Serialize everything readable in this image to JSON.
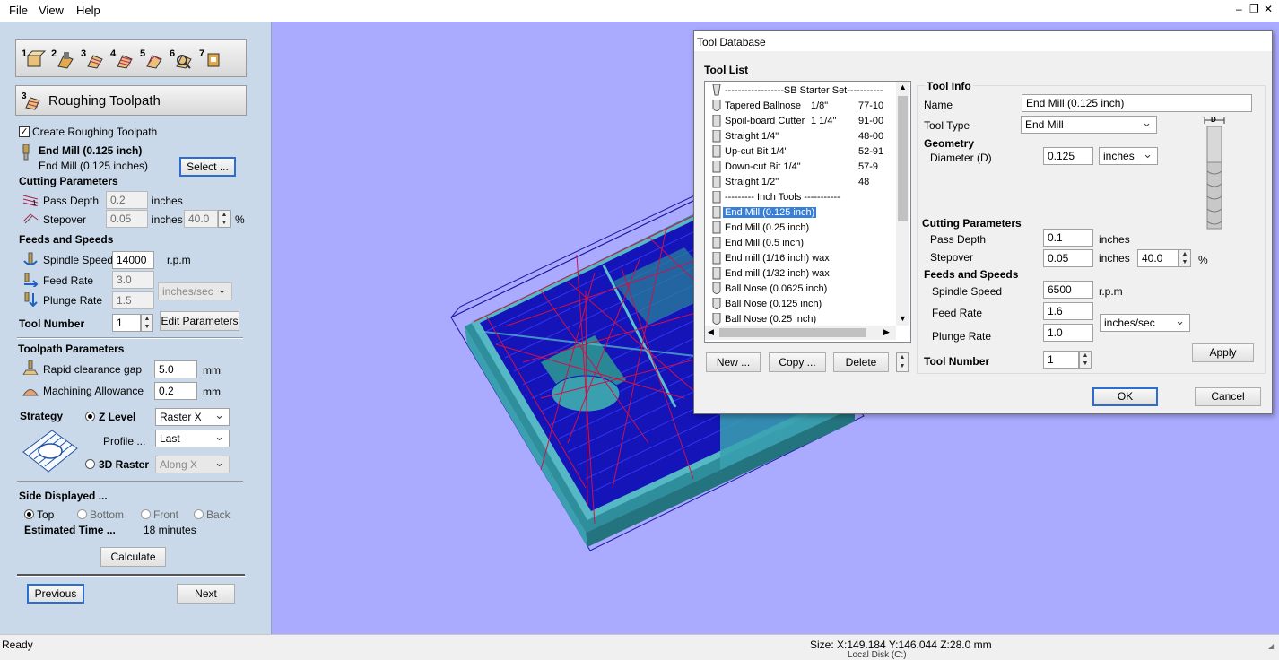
{
  "menu": {
    "file": "File",
    "view": "View",
    "help": "Help"
  },
  "window_controls": {
    "minimize": "–",
    "restore": "❐",
    "close": "✕"
  },
  "left": {
    "toolbar_numbers": [
      "1",
      "2",
      "3",
      "4",
      "5",
      "6",
      "7"
    ],
    "section_number": "3",
    "section_title": "Roughing Toolpath",
    "create_label": "Create Roughing Toolpath",
    "tool_name_bold": "End Mill (0.125 inch)",
    "tool_name": "End Mill (0.125 inches)",
    "select_button": "Select ...",
    "cutting_params": "Cutting Parameters",
    "pass_depth_label": "Pass Depth",
    "pass_depth_value": "0.2",
    "pass_depth_unit": "inches",
    "stepover_label": "Stepover",
    "stepover_value": "0.05",
    "stepover_unit": "inches",
    "stepover_pct": "40.0",
    "pct_sign": "%",
    "feeds_speeds": "Feeds and Speeds",
    "spindle_label": "Spindle Speed",
    "spindle_value": "14000",
    "spindle_unit": "r.p.m",
    "feed_label": "Feed Rate",
    "feed_value": "3.0",
    "plunge_label": "Plunge Rate",
    "plunge_value": "1.5",
    "rate_unit": "inches/sec",
    "tool_number_label": "Tool Number",
    "tool_number_value": "1",
    "edit_params_button": "Edit Parameters",
    "toolpath_params": "Toolpath Parameters",
    "rapid_label": "Rapid clearance gap",
    "rapid_value": "5.0",
    "rapid_unit": "mm",
    "allowance_label": "Machining Allowance",
    "allowance_value": "0.2",
    "allowance_unit": "mm",
    "strategy_label": "Strategy",
    "zlevel_label": "Z Level",
    "zlevel_select": "Raster X",
    "profile_label": "Profile ...",
    "profile_select": "Last",
    "raster3d_label": "3D Raster",
    "raster3d_select": "Along X",
    "side_displayed": "Side Displayed ...",
    "side_top": "Top",
    "side_bottom": "Bottom",
    "side_front": "Front",
    "side_back": "Back",
    "est_time_label": "Estimated Time ...",
    "est_time_value": "18 minutes",
    "calculate_button": "Calculate",
    "previous_button": "Previous",
    "next_button": "Next"
  },
  "status": {
    "left": "Ready",
    "size": "Size: X:149.184 Y:146.044 Z:28.0 mm",
    "taskbar_hint": "Local Disk (C:)"
  },
  "dialog": {
    "title": "Tool Database",
    "tool_list_label": "Tool List",
    "tools": [
      {
        "name": "------------------SB Starter Set-----------",
        "dia": "",
        "part": ""
      },
      {
        "name": "Tapered Ballnose",
        "dia": "1/8\"",
        "part": "77-10"
      },
      {
        "name": "Spoil-board Cutter",
        "dia": "1 1/4\"",
        "part": "91-00"
      },
      {
        "name": "Straight 1/4\"",
        "dia": "",
        "part": "48-00"
      },
      {
        "name": "Up-cut Bit 1/4\"",
        "dia": "",
        "part": "52-91"
      },
      {
        "name": "Down-cut Bit 1/4\"",
        "dia": "",
        "part": "57-9"
      },
      {
        "name": "Straight 1/2\"",
        "dia": "",
        "part": "48"
      },
      {
        "name": "--------- Inch Tools -----------",
        "dia": "",
        "part": ""
      },
      {
        "name": "End Mill (0.125 inch)",
        "dia": "",
        "part": ""
      },
      {
        "name": "End Mill (0.25 inch)",
        "dia": "",
        "part": ""
      },
      {
        "name": "End Mill (0.5 inch)",
        "dia": "",
        "part": ""
      },
      {
        "name": "End mill (1/16 inch) wax",
        "dia": "",
        "part": ""
      },
      {
        "name": "End mill (1/32 inch) wax",
        "dia": "",
        "part": ""
      },
      {
        "name": "Ball Nose (0.0625 inch)",
        "dia": "",
        "part": ""
      },
      {
        "name": "Ball Nose (0.125 inch)",
        "dia": "",
        "part": ""
      },
      {
        "name": "Ball Nose (0.25 inch)",
        "dia": "",
        "part": ""
      }
    ],
    "new_button": "New ...",
    "copy_button": "Copy ...",
    "delete_button": "Delete",
    "tool_info": "Tool Info",
    "name_label": "Name",
    "name_value": "End Mill (0.125 inch)",
    "tool_type_label": "Tool Type",
    "tool_type_value": "End Mill",
    "geometry": "Geometry",
    "diameter_label": "Diameter (D)",
    "diameter_value": "0.125",
    "diameter_unit": "inches",
    "diagram_letter": "D",
    "cutting_params": "Cutting Parameters",
    "pass_depth_label": "Pass Depth",
    "pass_depth_value": "0.1",
    "pass_depth_unit": "inches",
    "stepover_label": "Stepover",
    "stepover_value": "0.05",
    "stepover_unit": "inches",
    "stepover_pct": "40.0",
    "pct_sign": "%",
    "feeds_speeds": "Feeds and Speeds",
    "spindle_label": "Spindle Speed",
    "spindle_value": "6500",
    "spindle_unit": "r.p.m",
    "feed_label": "Feed Rate",
    "feed_value": "1.6",
    "plunge_label": "Plunge Rate",
    "plunge_value": "1.0",
    "rate_unit": "inches/sec",
    "tool_number_label": "Tool Number",
    "tool_number_value": "1",
    "apply_button": "Apply",
    "ok_button": "OK",
    "cancel_button": "Cancel"
  },
  "colors": {
    "viewport_bg": "#aaaaff",
    "panel_bg": "#c9d9e9",
    "select_blue": "#3a7fd6",
    "toolpath_blue": "#1010d0",
    "toolpath_red": "#d01040",
    "material_teal": "#3aa0b0"
  }
}
